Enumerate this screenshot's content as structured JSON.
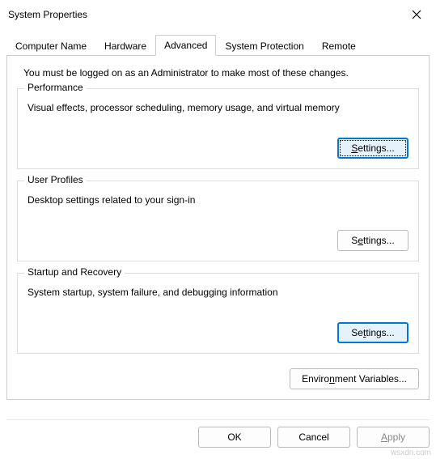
{
  "window": {
    "title": "System Properties"
  },
  "tabs": {
    "computer_name": "Computer Name",
    "hardware": "Hardware",
    "advanced": "Advanced",
    "system_protection": "System Protection",
    "remote": "Remote"
  },
  "admin_note": "You must be logged on as an Administrator to make most of these changes.",
  "groups": {
    "performance": {
      "title": "Performance",
      "desc": "Visual effects, processor scheduling, memory usage, and virtual memory",
      "button": "Settings..."
    },
    "user_profiles": {
      "title": "User Profiles",
      "desc": "Desktop settings related to your sign-in",
      "button": "Settings..."
    },
    "startup_recovery": {
      "title": "Startup and Recovery",
      "desc": "System startup, system failure, and debugging information",
      "button": "Settings..."
    }
  },
  "env_button": "Environment Variables...",
  "buttons": {
    "ok": "OK",
    "cancel": "Cancel",
    "apply": "Apply"
  },
  "watermark": "wsxdn.com"
}
